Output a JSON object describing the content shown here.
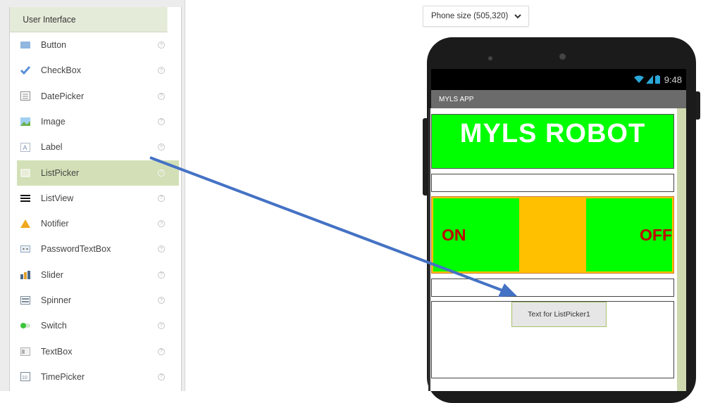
{
  "palette": {
    "header": "User Interface",
    "items": [
      {
        "label": "Button",
        "icon": "button-icon",
        "icon_color": "#8fb7e0",
        "selected": false
      },
      {
        "label": "CheckBox",
        "icon": "checkbox-icon",
        "icon_color": "#5b8fd6",
        "selected": false
      },
      {
        "label": "DatePicker",
        "icon": "calendar-icon",
        "icon_color": "#8a8a8a",
        "selected": false
      },
      {
        "label": "Image",
        "icon": "image-icon",
        "icon_color": "#6ab04c",
        "selected": false
      },
      {
        "label": "Label",
        "icon": "label-icon",
        "icon_color": "#7a8fb0",
        "selected": false
      },
      {
        "label": "ListPicker",
        "icon": "listpicker-icon",
        "icon_color": "#e8ecd8",
        "selected": true
      },
      {
        "label": "ListView",
        "icon": "listview-icon",
        "icon_color": "#111111",
        "selected": false
      },
      {
        "label": "Notifier",
        "icon": "warning-icon",
        "icon_color": "#f0a81c",
        "selected": false
      },
      {
        "label": "PasswordTextBox",
        "icon": "password-icon",
        "icon_color": "#8fa8c0",
        "selected": false
      },
      {
        "label": "Slider",
        "icon": "slider-icon",
        "icon_color": "#e0a030",
        "selected": false
      },
      {
        "label": "Spinner",
        "icon": "spinner-icon",
        "icon_color": "#7a8a9a",
        "selected": false
      },
      {
        "label": "Switch",
        "icon": "switch-icon",
        "icon_color": "#3cc43c",
        "selected": false
      },
      {
        "label": "TextBox",
        "icon": "textbox-icon",
        "icon_color": "#b0b0b0",
        "selected": false
      },
      {
        "label": "TimePicker",
        "icon": "clock-icon",
        "icon_color": "#7a8a9a",
        "selected": false
      }
    ],
    "help_glyph": "?"
  },
  "device_select": {
    "value": "Phone size (505,320)"
  },
  "phone": {
    "time": "9:48",
    "app_title": "MYLS APP",
    "robot_title": "MYLS ROBOT",
    "on_label": "ON",
    "off_label": "OFF",
    "listpicker_text": "Text for ListPicker1"
  },
  "colors": {
    "bright_green": "#00ff00",
    "orange": "#ffc000",
    "red_text": "#c00000",
    "arrow": "#4472c4",
    "selection": "#d3e0b7"
  }
}
